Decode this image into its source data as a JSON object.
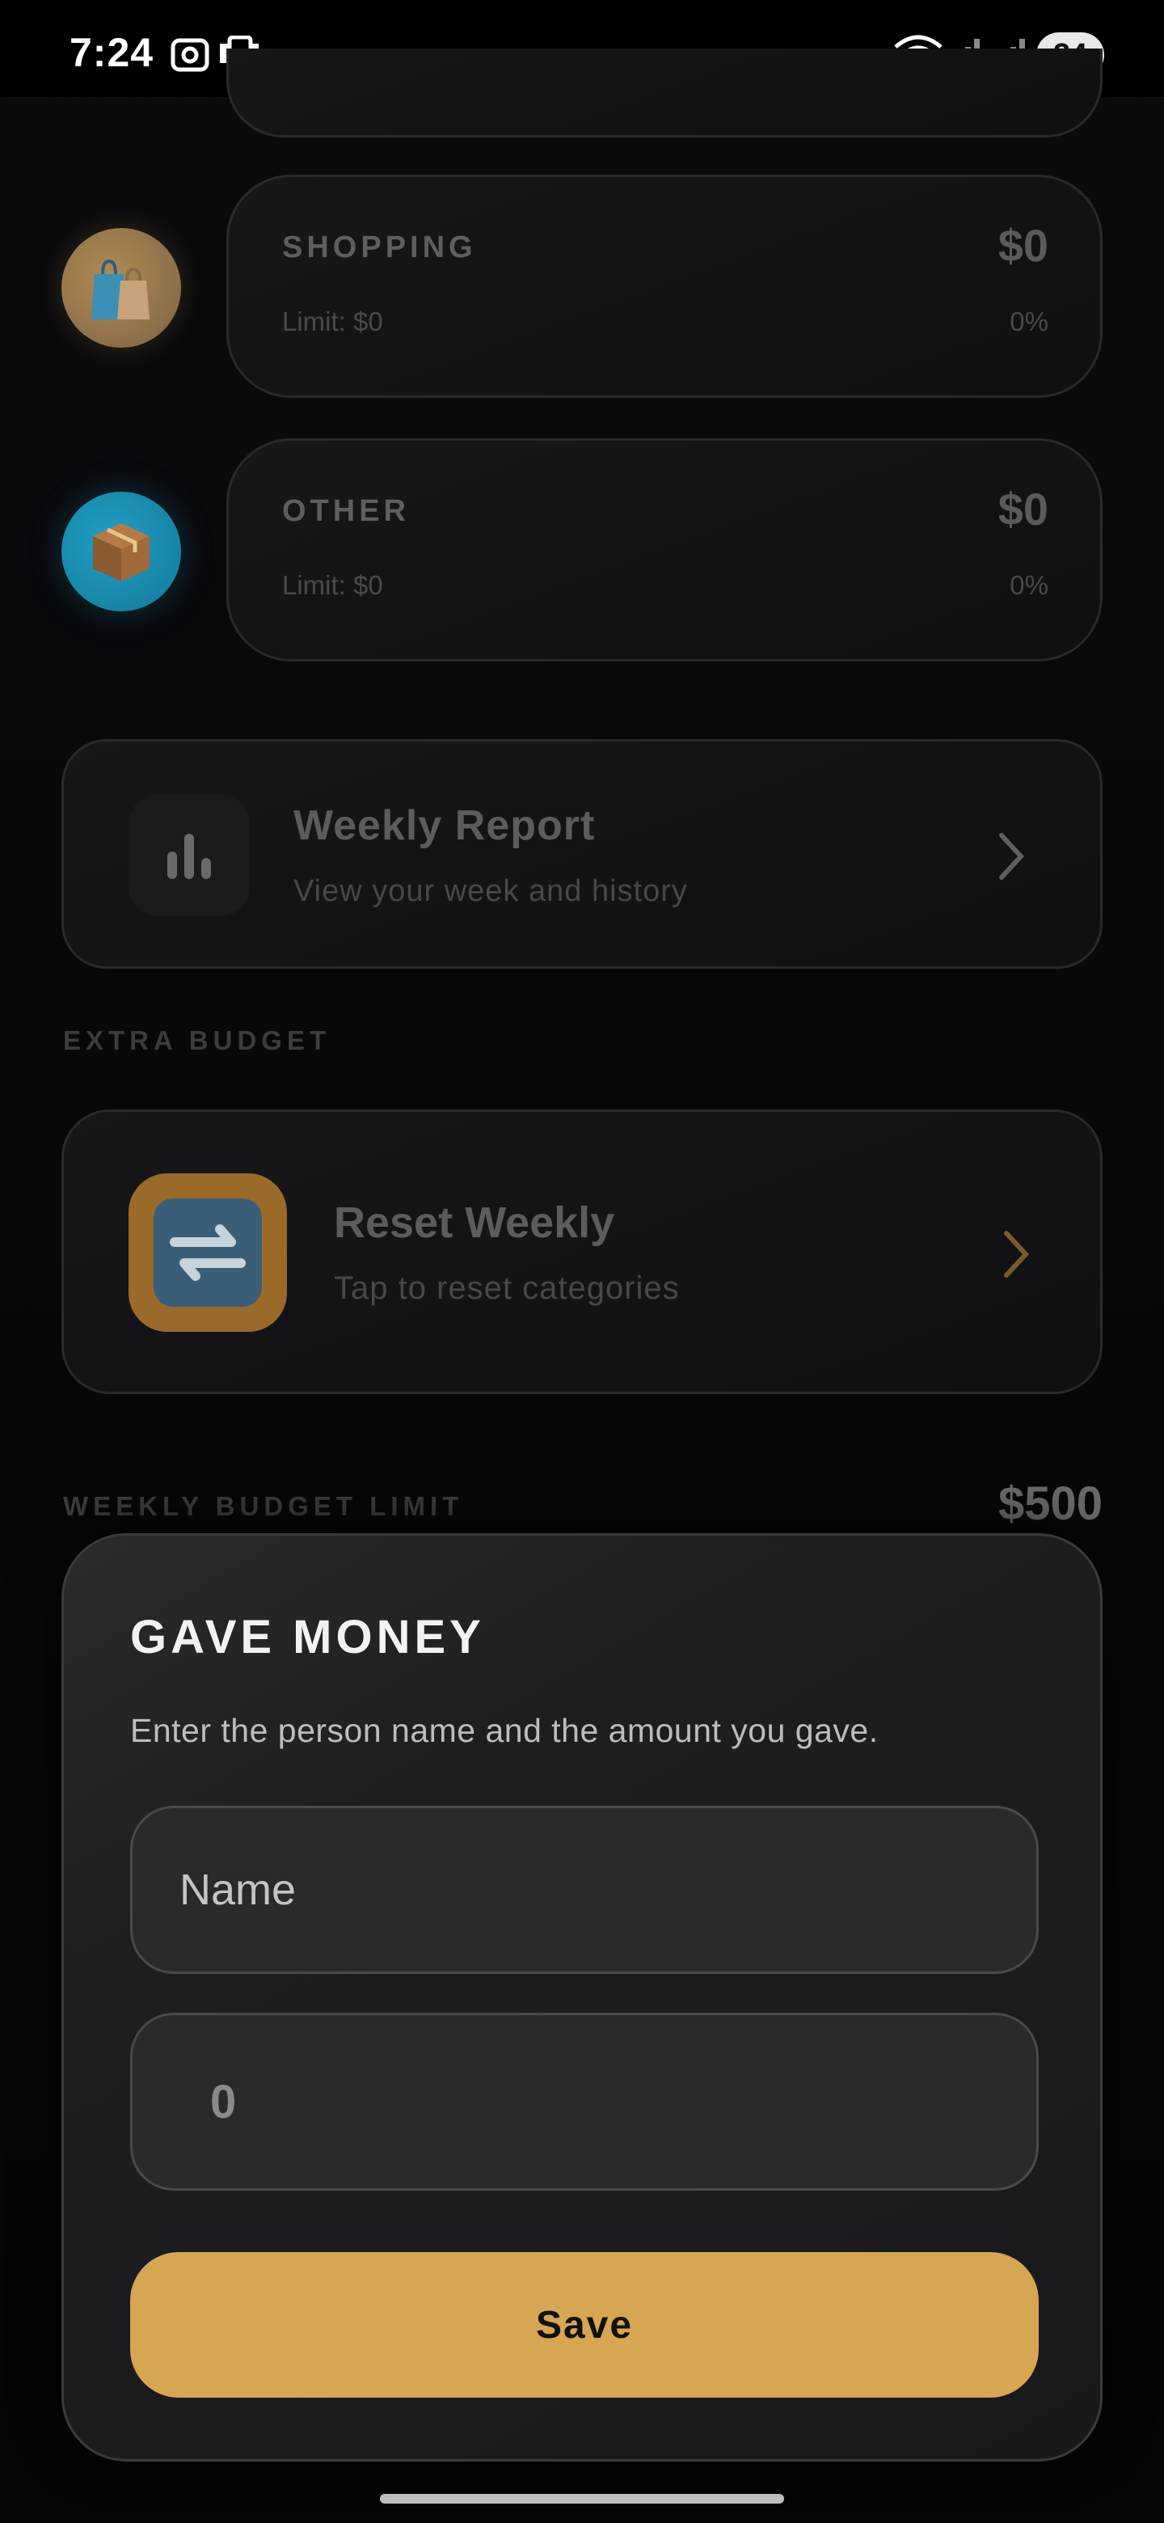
{
  "status_bar": {
    "time": "7:24",
    "battery": "24"
  },
  "categories": [
    {
      "name": "SHOPPING",
      "amount": "$0",
      "limit": "Limit: $0",
      "percent": "0%",
      "icon": "shopping-bags-icon"
    },
    {
      "name": "OTHER",
      "amount": "$0",
      "limit": "Limit: $0",
      "percent": "0%",
      "icon": "package-box-icon"
    }
  ],
  "weekly_report": {
    "title": "Weekly Report",
    "subtitle": "View your week and history",
    "icon": "bar-chart-icon"
  },
  "extra_budget": {
    "section_label": "EXTRA BUDGET",
    "reset": {
      "title": "Reset Weekly",
      "subtitle": "Tap to reset categories",
      "icon": "repeat-arrows-icon"
    }
  },
  "weekly_budget_limit": {
    "label": "WEEKLY BUDGET LIMIT",
    "amount": "$500"
  },
  "dialog": {
    "title": "GAVE MONEY",
    "subtitle": "Enter the person name and the amount you gave.",
    "name_placeholder": "Name",
    "amount_placeholder": "0",
    "save_label": "Save"
  },
  "colors": {
    "accent": "#d6a652",
    "background": "#060608",
    "card": "#151518"
  }
}
